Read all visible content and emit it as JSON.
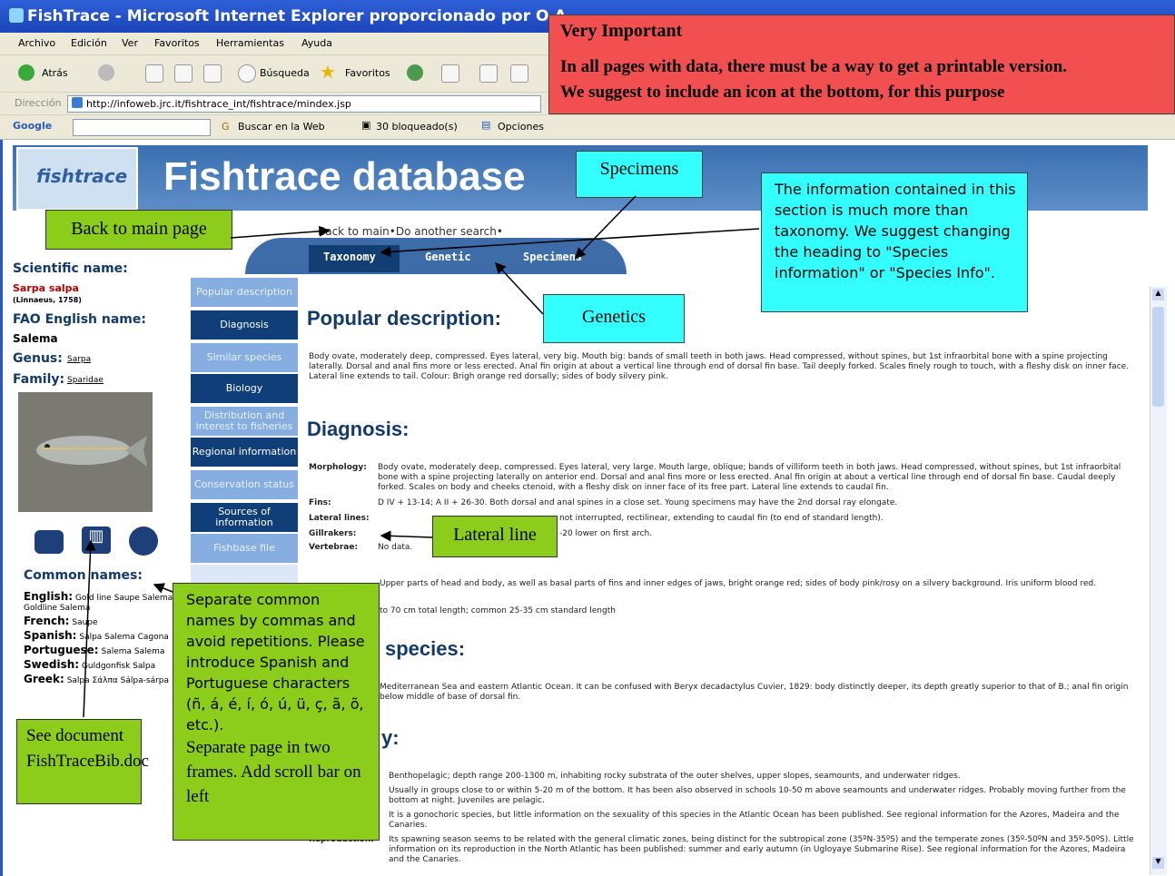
{
  "window": {
    "title": "FishTrace - Microsoft Internet Explorer proporcionado por O.A."
  },
  "menu": [
    "Archivo",
    "Edición",
    "Ver",
    "Favoritos",
    "Herramientas",
    "Ayuda"
  ],
  "toolbar": {
    "back_label": "Atrás",
    "search_label": "Búsqueda",
    "favorites_label": "Favoritos"
  },
  "address": {
    "label": "Dirección",
    "url": "http://infoweb.jrc.it/fishtrace_int/fishtrace/mindex.jsp"
  },
  "google_bar": {
    "logo": "Google",
    "search_web": "Buscar en la Web",
    "blocked": "30 bloqueado(s)",
    "options": "Opciones"
  },
  "page": {
    "db_title": "Fishtrace database",
    "logo_text": "fishtrace",
    "nav_back": "Back to main",
    "nav_search": "Do another search",
    "tabs": [
      "Taxonomy",
      "Genetic",
      "Specimens"
    ],
    "scientific_name_label": "Scientific name:",
    "scientific_name": "Sarpa salpa",
    "author": "(Linnaeus, 1758)",
    "fao_label": "FAO English name:",
    "fao_name": "Salema",
    "genus_label": "Genus:",
    "genus": "Sarpa",
    "family_label": "Family:",
    "family": "Sparidae",
    "common_names_label": "Common names:",
    "common_names": [
      {
        "lang": "English:",
        "names": "Gold line Saupe Salema Goldline Salema"
      },
      {
        "lang": "French:",
        "names": "Saupe"
      },
      {
        "lang": "Spanish:",
        "names": "Salpa Salema Cagona"
      },
      {
        "lang": "Portuguese:",
        "names": "Salema Salema"
      },
      {
        "lang": "Swedish:",
        "names": "Guldgonfisk Salpa"
      },
      {
        "lang": "Greek:",
        "names": "Salpa Σάλπα Sálpa-sárpa"
      }
    ],
    "sidebar": [
      "Popular description",
      "Diagnosis",
      "Similar species",
      "Biology",
      "Distribution and interest to fisheries",
      "Regional information",
      "Conservation status",
      "Sources of information",
      "Fishbase file"
    ],
    "popular_title": "Popular description:",
    "popular_text": "Body ovate, moderately deep, compressed. Eyes lateral, very big. Mouth big: bands of small teeth in both jaws. Head compressed, without spines, but 1st infraorbital bone with a spine projecting laterally. Dorsal and anal fins more or less erected. Anal fin origin at about a vertical line through end of dorsal fin base. Tail deeply forked. Scales finely rough to touch, with a fleshy disk on inner face. Lateral line extends to tail. Colour: Brigh orange red dorsally; sides of body silvery pink.",
    "diagnosis_title": "Diagnosis:",
    "diagnosis_rows": [
      {
        "label": "Morphology:",
        "text": "Body ovate, moderately deep, compressed. Eyes lateral, very large. Mouth large, oblique; bands of villiform teeth in both jaws. Head compressed, without spines, but 1st infraorbital bone with a spine projecting laterally on anterior end. Dorsal and anal fins more or less erected. Anal fin origin at about a vertical line through end of dorsal fin base. Caudal deeply forked. Scales on body and cheeks ctenoid, with a fleshy disk on inner face of its free part. Lateral line extends to caudal fin."
      },
      {
        "label": "Fins:",
        "text": "D IV + 13-14; A II + 26-30. Both dorsal and anal spines in a close set. Young specimens may have the 2nd dorsal ray elongate."
      },
      {
        "label": "Lateral lines:",
        "text": "not interrupted, rectilinear, extending to caudal fin (to end of standard length)."
      },
      {
        "label": "Gillrakers:",
        "text": "-20 lower on first arch."
      },
      {
        "label": "Vertebrae:",
        "text": "No data."
      }
    ],
    "colour_text": "Upper parts of head and body, as well as basal parts of fins and inner edges of jaws, bright orange red; sides of body pink/rosy on a silvery background. Iris uniform blood red.",
    "size_text": "to 70 cm total length; common 25-35 cm standard length",
    "similar_title": "species:",
    "similar_text": "Mediterranean Sea and eastern Atlantic Ocean. It can be confused with Beryx decadactylus Cuvier, 1829: body distinctly deeper, its depth greatly superior to that of B.; anal fin origin below middle of base of dorsal fin.",
    "biology_title": "y:",
    "biology_rows": [
      {
        "label": "",
        "text": "Benthopelagic; depth range 200-1300 m, inhabiting rocky substrata of the outer shelves, upper slopes, seamounts, and underwater ridges."
      },
      {
        "label": "",
        "text": "Usually in groups close to or within 5-20 m of the bottom. It has been also observed in schools 10-50 m above seamounts and underwater ridges. Probably moving further from the bottom at night. Juveniles are pelagic."
      },
      {
        "label": "",
        "text": "It is a gonochoric species, but little information on the sexuality of this species in the Atlantic Ocean has been published. See regional information for the Azores, Madeira and the Canaries."
      },
      {
        "label": "Reproduction:",
        "text": "Its spawning season seems to be related with the general climatic zones, being distinct for the subtropical zone (35ºN-35ºS) and the temperate zones (35º-50ºN and 35º-50ºS). Little information on its reproduction in the North Atlantic has been published: summer and early autumn (in Ugloyaye Submarine Rise). See regional information for the Azores, Madeira and the Canaries."
      }
    ]
  },
  "annotations": {
    "very_important_title": "Very Important",
    "very_important_l1": "In all pages with data, there must be a way to get a printable version.",
    "very_important_l2": "We suggest to include an icon at the bottom, for this purpose",
    "specimens": "Specimens",
    "taxonomy_note": "The information contained in this section is much more than taxonomy. We suggest changing the heading to \"Species information\" or \"Species Info\".",
    "back_to_main": "Back to main page",
    "genetics": "Genetics",
    "lateral_line": "Lateral line",
    "common_names_note": "Separate common names by commas and avoid repetitions. Please introduce Spanish and Portuguese characters (ñ, á, é, í, ó, ú, ü, ç, ã, õ, etc.).",
    "frames_note": "Separate page in two frames. Add scroll bar on left",
    "see_document": "See document FishTraceBib.doc"
  }
}
